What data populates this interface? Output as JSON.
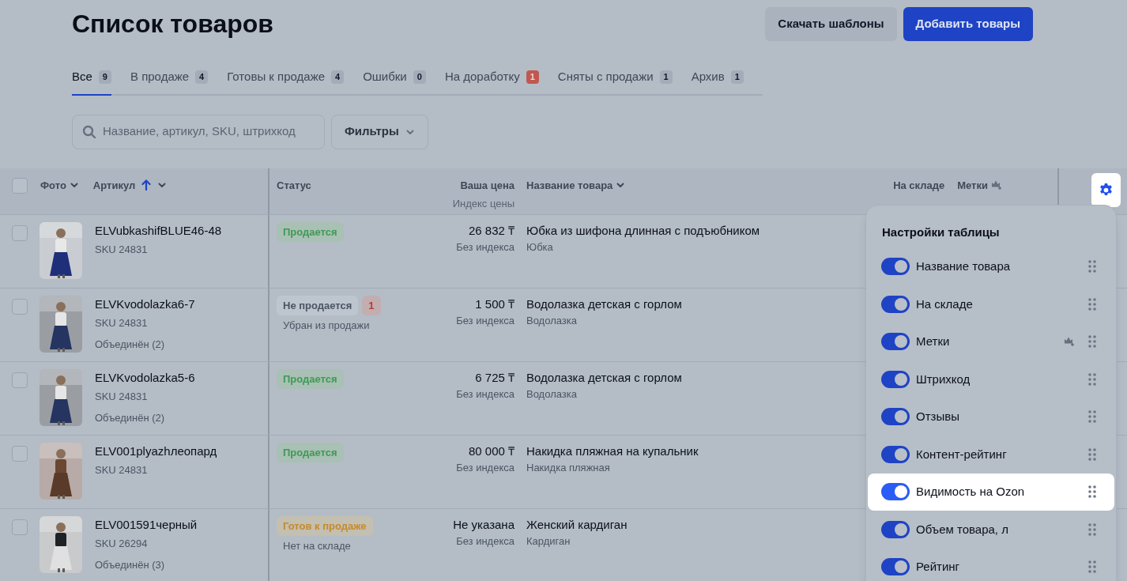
{
  "title": "Список товаров",
  "header_buttons": [
    {
      "label": "Скачать шаблоны",
      "kind": "secondary"
    },
    {
      "label": "Добавить товары",
      "kind": "primary"
    }
  ],
  "tabs": [
    {
      "label": "Все",
      "count": "9",
      "selected": true,
      "alert": false
    },
    {
      "label": "В продаже",
      "count": "4",
      "selected": false,
      "alert": false
    },
    {
      "label": "Готовы к продаже",
      "count": "4",
      "selected": false,
      "alert": false
    },
    {
      "label": "Ошибки",
      "count": "0",
      "selected": false,
      "alert": false
    },
    {
      "label": "На доработку",
      "count": "1",
      "selected": false,
      "alert": true
    },
    {
      "label": "Сняты с продажи",
      "count": "1",
      "selected": false,
      "alert": false
    },
    {
      "label": "Архив",
      "count": "1",
      "selected": false,
      "alert": false
    }
  ],
  "search": {
    "placeholder": "Название, артикул, SKU, штрихкод"
  },
  "filter_button": {
    "label": "Фильтры"
  },
  "table": {
    "columns": {
      "photo": "Фото",
      "article": "Артикул",
      "status": "Статус",
      "price": "Ваша цена",
      "price_index": "Индекс цены",
      "name": "Название товара",
      "stock": "На складе",
      "tags": "Метки"
    },
    "select_all_checked": false,
    "rows": [
      {
        "article": "ELVubkashifBLUE46-48",
        "sku": "SKU 24831",
        "status": {
          "label": "Продается",
          "kind": "selling"
        },
        "price": "26 832 ₸",
        "price_index": "Без индекса",
        "name": "Юбка из шифона длинная с подъюбником",
        "category": "Юбка",
        "checked": false
      },
      {
        "article": "ELVKvodolazka6-7",
        "sku": "SKU 24831",
        "merged": "Объединён (2)",
        "status": {
          "label": "Не продается",
          "kind": "not_selling",
          "count": "1",
          "note": "Убран из продажи"
        },
        "price": "1 500 ₸",
        "price_index": "Без индекса",
        "name": "Водолазка детская с горлом",
        "category": "Водолазка",
        "checked": false
      },
      {
        "article": "ELVKvodolazka5-6",
        "sku": "SKU 24831",
        "merged": "Объединён (2)",
        "status": {
          "label": "Продается",
          "kind": "selling"
        },
        "price": "6 725 ₸",
        "price_index": "Без индекса",
        "name": "Водолазка детская с горлом",
        "category": "Водолазка",
        "checked": false
      },
      {
        "article": "ELV001plyazhлеопард",
        "sku": "SKU 24831",
        "status": {
          "label": "Продается",
          "kind": "selling"
        },
        "price": "80 000 ₸",
        "price_index": "Без индекса",
        "name": "Накидка пляжная на купальник",
        "category": "Накидка пляжная",
        "checked": false
      },
      {
        "article": "ELV001591черный",
        "sku": "SKU 26294",
        "merged": "Объединён (3)",
        "status": {
          "label": "Готов к продаже",
          "kind": "ready",
          "note": "Нет на складе"
        },
        "price": "Не указана",
        "price_index": "Без индекса",
        "name": "Женский кардиган",
        "category": "Кардиган",
        "checked": false
      }
    ]
  },
  "settings_button": {
    "highlighted": true
  },
  "settings_panel": {
    "title": "Настройки таблицы",
    "items": [
      {
        "label": "Название товара",
        "on": true,
        "highlighted": false,
        "tag_icon": false
      },
      {
        "label": "На складе",
        "on": true,
        "highlighted": false,
        "tag_icon": false
      },
      {
        "label": "Метки",
        "on": true,
        "highlighted": false,
        "tag_icon": true
      },
      {
        "label": "Штрихкод",
        "on": true,
        "highlighted": false,
        "tag_icon": false
      },
      {
        "label": "Отзывы",
        "on": true,
        "highlighted": false,
        "tag_icon": false
      },
      {
        "label": "Контент-рейтинг",
        "on": true,
        "highlighted": false,
        "tag_icon": false
      },
      {
        "label": "Видимость на Ozon",
        "on": true,
        "highlighted": true,
        "tag_icon": false
      },
      {
        "label": "Объем товара, л",
        "on": true,
        "highlighted": false,
        "tag_icon": false
      },
      {
        "label": "Рейтинг",
        "on": true,
        "highlighted": false,
        "tag_icon": false
      }
    ]
  }
}
